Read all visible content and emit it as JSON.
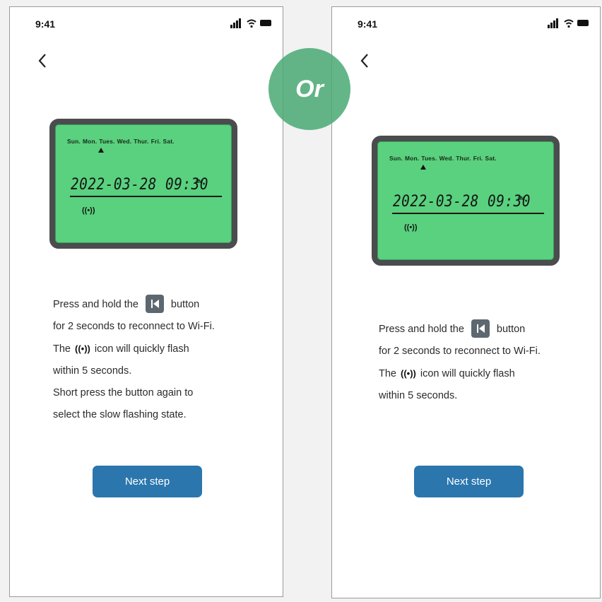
{
  "divider": {
    "label": "Or"
  },
  "screens": [
    {
      "status_time": "9:41",
      "lcd": {
        "days": [
          "Sun.",
          "Mon.",
          "Tues.",
          "Wed.",
          "Thur.",
          "Fri.",
          "Sat."
        ],
        "datetime": "2022-03-28 09:30",
        "ampm": "AM",
        "signal_glyph": "((•))"
      },
      "instructions": {
        "line1_before": "Press and hold the",
        "line1_after": "button",
        "line2": "for 2 seconds to reconnect to Wi-Fi.",
        "line3_before": "The",
        "signal_glyph": "((•))",
        "line3_after": "icon will quickly flash",
        "line4": "within 5 seconds.",
        "line5": "Short press the button again to",
        "line6": "select the slow flashing state."
      },
      "next_button": "Next step"
    },
    {
      "status_time": "9:41",
      "lcd": {
        "days": [
          "Sun.",
          "Mon.",
          "Tues.",
          "Wed.",
          "Thur.",
          "Fri.",
          "Sat."
        ],
        "datetime": "2022-03-28 09:30",
        "ampm": "AM",
        "signal_glyph": "((•))"
      },
      "instructions": {
        "line1_before": "Press and hold the",
        "line1_after": "button",
        "line2": "for 2 seconds to reconnect to Wi-Fi.",
        "line3_before": "The",
        "signal_glyph": "((•))",
        "line3_after": "icon will quickly flash",
        "line4": "within 5 seconds."
      },
      "next_button": "Next step"
    }
  ],
  "icons": {
    "back": "chevron-left-icon",
    "cellular": "signal-bars-icon",
    "wifi": "wifi-icon",
    "battery": "battery-icon",
    "skip_back": "skip-back-icon",
    "broadcast": "broadcast-signal-icon"
  },
  "colors": {
    "lcd_screen": "#59d17e",
    "lcd_frame": "#4a4c4e",
    "button": "#2b76ad",
    "or_badge": "#4aaa76"
  }
}
